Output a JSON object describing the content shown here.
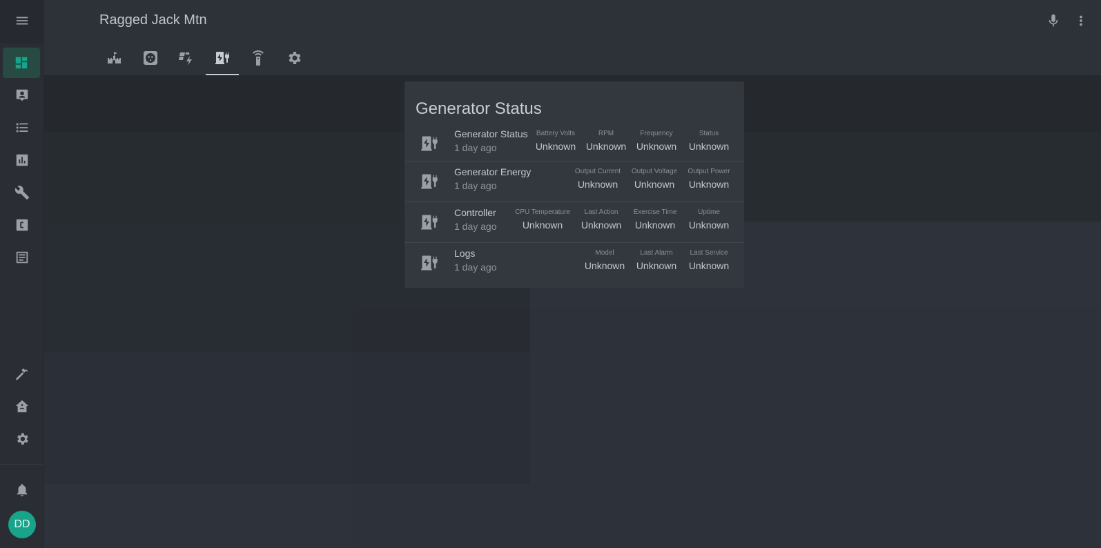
{
  "app": {
    "title": "Ragged Jack Mtn"
  },
  "header": {
    "tabs": [
      {
        "icon": "castle-icon"
      },
      {
        "icon": "power-socket-icon"
      },
      {
        "icon": "solar-power-icon"
      },
      {
        "icon": "ev-station-icon"
      },
      {
        "icon": "remote-icon"
      },
      {
        "icon": "gear-icon"
      }
    ],
    "active_tab": 3,
    "actions": [
      {
        "icon": "microphone-icon"
      },
      {
        "icon": "more-vert-icon"
      }
    ]
  },
  "sidebar": {
    "items": [
      {
        "icon": "menu-icon"
      },
      {
        "icon": "dashboard-icon"
      },
      {
        "icon": "account-box-icon"
      },
      {
        "icon": "format-list-icon"
      },
      {
        "icon": "chart-box-icon"
      },
      {
        "icon": "wrench-icon"
      },
      {
        "icon": "alpha-c-box-icon"
      },
      {
        "icon": "text-box-icon"
      },
      {
        "icon": "hammer-icon"
      },
      {
        "icon": "home-assistant-icon"
      },
      {
        "icon": "cog-icon"
      },
      {
        "icon": "bell-icon"
      }
    ],
    "avatar": "DD"
  },
  "card": {
    "title": "Generator Status",
    "rows": [
      {
        "name": "Generator Status",
        "time": "1 day ago",
        "attrs": [
          {
            "label": "Battery Volts",
            "value": "Unknown"
          },
          {
            "label": "RPM",
            "value": "Unknown"
          },
          {
            "label": "Frequency",
            "value": "Unknown"
          },
          {
            "label": "Status",
            "value": "Unknown"
          }
        ]
      },
      {
        "name": "Generator Energy",
        "time": "1 day ago",
        "attrs": [
          {
            "label": "Output Current",
            "value": "Unknown"
          },
          {
            "label": "Output Voltage",
            "value": "Unknown"
          },
          {
            "label": "Output Power",
            "value": "Unknown"
          }
        ]
      },
      {
        "name": "Controller",
        "time": "1 day ago",
        "attrs": [
          {
            "label": "CPU Temperature",
            "value": "Unknown"
          },
          {
            "label": "Last Action",
            "value": "Unknown"
          },
          {
            "label": "Exercise Time",
            "value": "Unknown"
          },
          {
            "label": "Uptime",
            "value": "Unknown"
          }
        ]
      },
      {
        "name": "Logs",
        "time": "1 day ago",
        "attrs": [
          {
            "label": "Model",
            "value": "Unknown"
          },
          {
            "label": "Last Alarm",
            "value": "Unknown"
          },
          {
            "label": "Last Service",
            "value": "Unknown"
          }
        ]
      }
    ]
  },
  "colors": {
    "accent": "#18a38a",
    "background": "#2e333b",
    "card": "#33383f"
  }
}
